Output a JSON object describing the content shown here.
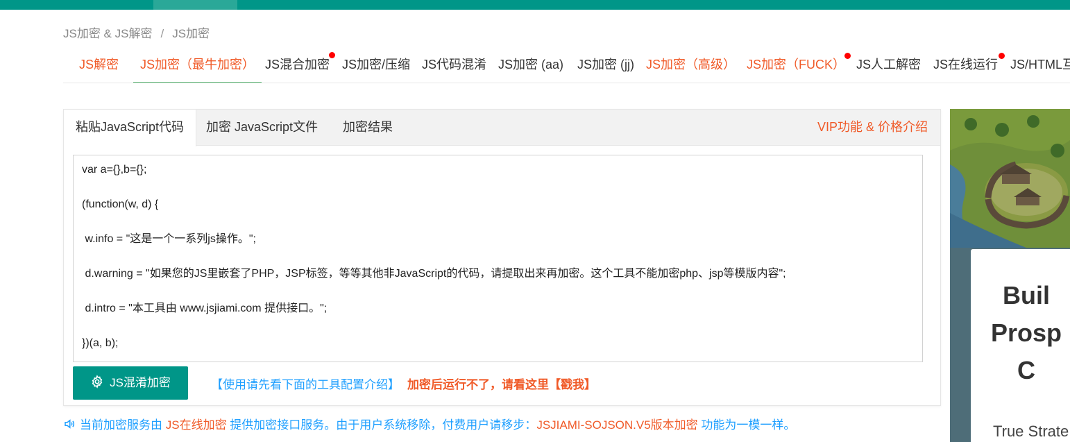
{
  "breadcrumb": {
    "parent": "JS加密 & JS解密",
    "separator": "/",
    "current": "JS加密"
  },
  "tabs": [
    {
      "label": "JS解密"
    },
    {
      "label": "JS加密（最牛加密）"
    },
    {
      "label": "JS混合加密"
    },
    {
      "label": "JS加密/压缩"
    },
    {
      "label": "JS代码混淆"
    },
    {
      "label": "JS加密 (aa)"
    },
    {
      "label": "JS加密 (jj)"
    },
    {
      "label": "JS加密（高级）"
    },
    {
      "label": "JS加密（FUCK）"
    },
    {
      "label": "JS人工解密"
    },
    {
      "label": "JS在线运行"
    },
    {
      "label": "JS/HTML互"
    }
  ],
  "card": {
    "tabs": [
      {
        "label": "粘贴JavaScript代码"
      },
      {
        "label": "加密 JavaScript文件"
      },
      {
        "label": "加密结果"
      }
    ],
    "vip_label": "VIP功能 & 价格介绍",
    "code_lines": [
      "var a={},b={};",
      "",
      "(function(w, d) {",
      "",
      " w.info = \"这是一个一系列js操作。\";",
      "",
      " d.warning = \"如果您的JS里嵌套了PHP，JSP标签，等等其他非JavaScript的代码，请提取出来再加密。这个工具不能加密php、jsp等模版内容\";",
      "",
      " d.intro = \"本工具由 www.jsjiami.com 提供接口。\";",
      "",
      "})(a, b);"
    ],
    "encrypt_button": "JS混淆加密",
    "help_link": "【使用请先看下面的工具配置介绍】",
    "warn_link": "加密后运行不了，请看这里【戳我】"
  },
  "notice": {
    "part1": "当前加密服务由",
    "link1": "JS在线加密",
    "part2": "提供加密接口服务。由于用户系统移除，付费用户请移步：",
    "link2": "JSJIAMI-SOJSON.V5版本加密",
    "part3": "功能为一模一样。"
  },
  "ad": {
    "title_lines": [
      "Buil",
      "Prosp",
      "C"
    ],
    "subtitle": "True Strate"
  },
  "colors": {
    "primary": "#009688",
    "accent": "#f05a28",
    "link": "#1e9fff",
    "dot": "#ff0000"
  }
}
